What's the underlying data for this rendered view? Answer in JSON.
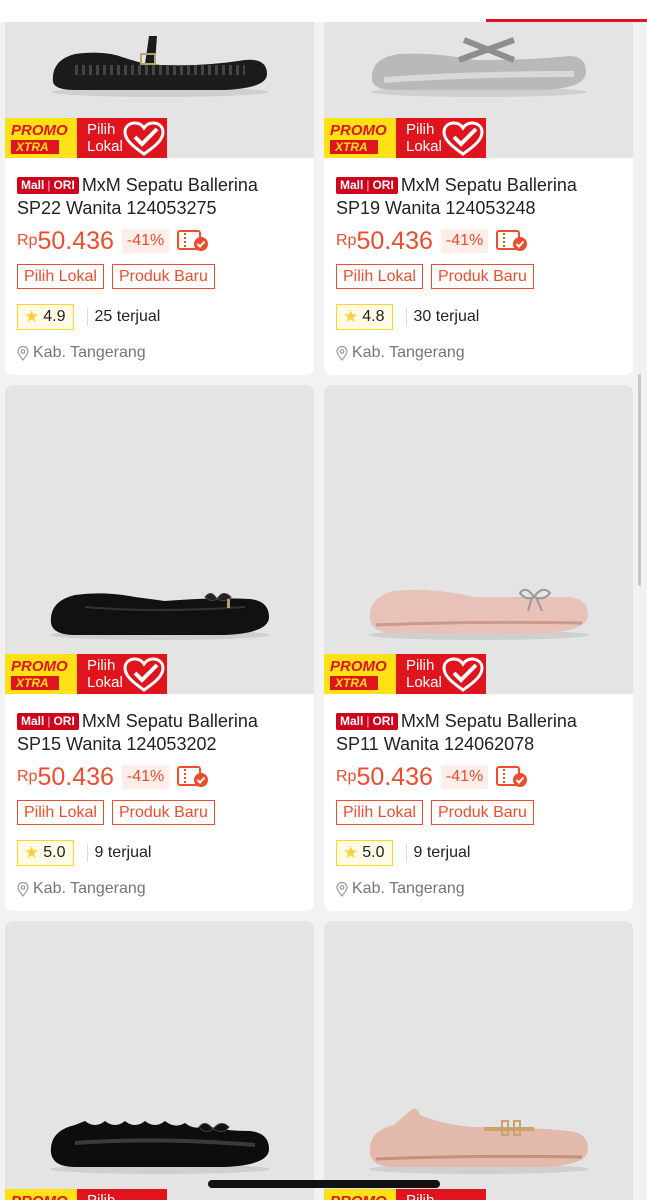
{
  "theme": {
    "accent": "#ee4d2d",
    "mall_red": "#d0011b",
    "promo_yellow": "#ffe116",
    "top_accent": "#e0141c"
  },
  "badge": {
    "promo": "PROMO",
    "xtra": "XTRA",
    "pilih": "Pilih",
    "lokal": "Lokal"
  },
  "mall": {
    "mall": "Mall",
    "ori": "ORI"
  },
  "currency": "Rp",
  "products": [
    {
      "title": "MxM Sepatu Ballerina SP22 Wanita 124053275",
      "price": "50.436",
      "discount": "-41%",
      "tags": [
        "Pilih Lokal",
        "Produk Baru"
      ],
      "rating": "4.9",
      "sold": "25 terjual",
      "location": "Kab. Tangerang",
      "shoe": "black-perforated-mary-jane"
    },
    {
      "title": "MxM Sepatu Ballerina SP19 Wanita 124053248",
      "price": "50.436",
      "discount": "-41%",
      "tags": [
        "Pilih Lokal",
        "Produk Baru"
      ],
      "rating": "4.8",
      "sold": "30 terjual",
      "location": "Kab. Tangerang",
      "shoe": "silver-cross-strap"
    },
    {
      "title": "MxM Sepatu Ballerina SP15 Wanita 124053202",
      "price": "50.436",
      "discount": "-41%",
      "tags": [
        "Pilih Lokal",
        "Produk Baru"
      ],
      "rating": "5.0",
      "sold": "9 terjual",
      "location": "Kab. Tangerang",
      "shoe": "black-bow-flat"
    },
    {
      "title": "MxM Sepatu Ballerina SP11 Wanita 124062078",
      "price": "50.436",
      "discount": "-41%",
      "tags": [
        "Pilih Lokal",
        "Produk Baru"
      ],
      "rating": "5.0",
      "sold": "9 terjual",
      "location": "Kab. Tangerang",
      "shoe": "pink-bow-flat"
    },
    {
      "shoe": "black-patent-scallop-flat"
    },
    {
      "shoe": "pink-buckle-loafer"
    }
  ]
}
